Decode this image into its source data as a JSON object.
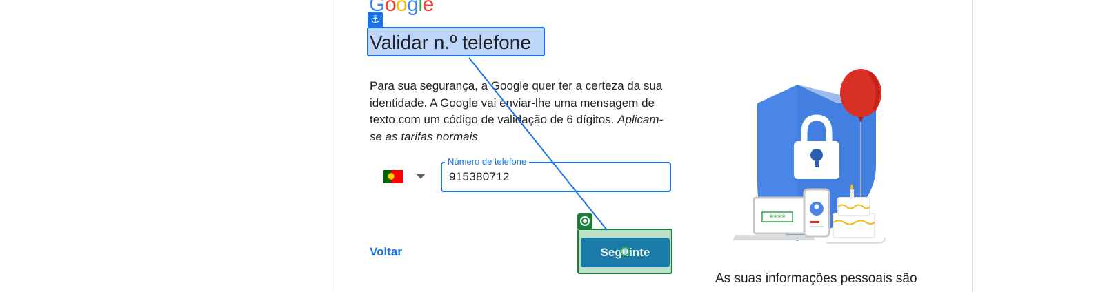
{
  "logo": {
    "letters": [
      "G",
      "o",
      "o",
      "g",
      "l",
      "e"
    ]
  },
  "header": {
    "title": "Validar n.º telefone"
  },
  "description": {
    "text": "Para sua segurança, a Google quer ter a certeza da sua identidade. A Google vai enviar-lhe uma mensagem de texto com um código de validação de 6 dígitos. ",
    "italic_text": "Aplicam-se as tarifas normais"
  },
  "phone": {
    "country_icon": "portugal-flag",
    "label": "Número de telefone",
    "value": "915380712"
  },
  "actions": {
    "back_label": "Voltar",
    "next_label": "Seguinte"
  },
  "illustration": {
    "password_mask": "****"
  },
  "footer": {
    "privacy_text": "As suas informações pessoais são"
  },
  "annotations": {
    "anchor_icon": "anchor-icon",
    "target_icon": "target-icon",
    "source_color": "#1a73e8",
    "target_color": "#188038"
  }
}
